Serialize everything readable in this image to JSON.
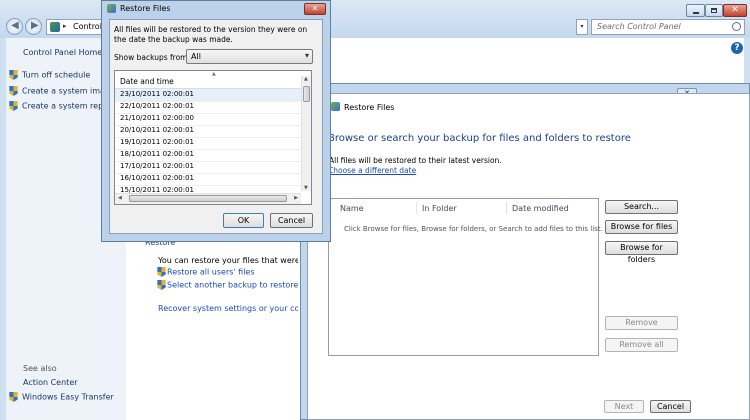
{
  "control_panel": {
    "breadcrumb": "Control",
    "search_placeholder": "Search Control Panel",
    "sidebar": {
      "home": "Control Panel Home",
      "items": [
        {
          "label": "Turn off schedule"
        },
        {
          "label": "Create a system image"
        },
        {
          "label": "Create a system repair d"
        }
      ],
      "see_also_title": "See also",
      "see_also": [
        {
          "label": "Action Center"
        },
        {
          "label": "Windows Easy Transfer"
        }
      ]
    },
    "main": {
      "restore_heading": "Restore",
      "restore_text": "You can restore your files that were backed",
      "link_all_users": "Restore all users' files",
      "link_another_backup": "Select another backup to restore files fro",
      "link_recover_settings": "Recover system settings or your computer"
    }
  },
  "wizard": {
    "title": "Restore Files",
    "heading": "Browse or search your backup for files and folders to restore",
    "subtext": "All files will be restored to their latest version.",
    "choose_date_link": "Choose a different date",
    "columns": [
      "Name",
      "In Folder",
      "Date modified"
    ],
    "empty_message": "Click Browse for files, Browse for folders, or Search to add files to this list.",
    "buttons": {
      "search": "Search...",
      "browse_files": "Browse for files",
      "browse_folders": "Browse for folders",
      "remove": "Remove",
      "remove_all": "Remove all",
      "next": "Next",
      "cancel": "Cancel"
    }
  },
  "dialog": {
    "title": "Restore Files",
    "description": "All files will be restored to the version they were on the date the backup was made.",
    "show_backups_label": "Show backups from:",
    "show_backups_value": "All",
    "list_header": "Date and time",
    "dates": [
      "23/10/2011 02:00:01",
      "22/10/2011 02:00:01",
      "21/10/2011 02:00:00",
      "20/10/2011 02:00:01",
      "19/10/2011 02:00:01",
      "18/10/2011 02:00:01",
      "17/10/2011 02:00:01",
      "16/10/2011 02:00:01",
      "15/10/2011 02:00:01"
    ],
    "ok": "OK",
    "cancel": "Cancel"
  },
  "icons": {
    "shield": "uac-shield-icon",
    "back": "back-arrow-icon",
    "forward": "forward-arrow-icon",
    "search": "search-icon",
    "help": "help-icon"
  }
}
